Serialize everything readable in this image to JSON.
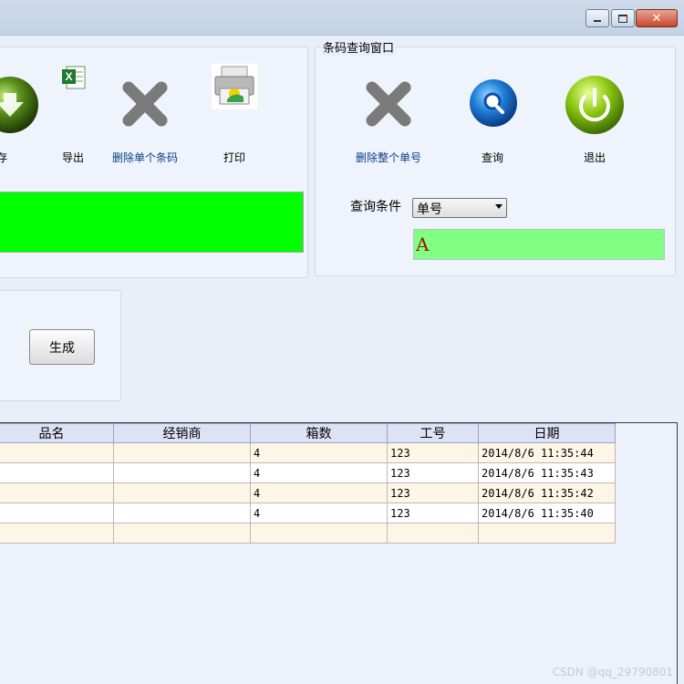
{
  "window": {
    "controls": [
      "minimize",
      "maximize",
      "close"
    ]
  },
  "toolbar": {
    "save_label": "保存",
    "export_label": "导出",
    "delete_single_label": "删除单个条码",
    "print_label": "打印"
  },
  "query_window": {
    "title": "条码查询窗口",
    "delete_order_label": "删除整个单号",
    "query_label": "查询",
    "exit_label": "退出",
    "condition_label": "查询条件",
    "condition_selected": "单号",
    "condition_value": "A"
  },
  "generate": {
    "button_label": "生成"
  },
  "grid": {
    "columns": [
      "品名",
      "经销商",
      "箱数",
      "工号",
      "日期"
    ],
    "rows": [
      {
        "name": "",
        "dealer": "",
        "boxes": "4",
        "worker_id": "123",
        "date": "2014/8/6 11:35:44"
      },
      {
        "name": "",
        "dealer": "",
        "boxes": "4",
        "worker_id": "123",
        "date": "2014/8/6 11:35:43"
      },
      {
        "name": "",
        "dealer": "",
        "boxes": "4",
        "worker_id": "123",
        "date": "2014/8/6 11:35:42"
      },
      {
        "name": "",
        "dealer": "",
        "boxes": "4",
        "worker_id": "123",
        "date": "2014/8/6 11:35:40"
      },
      {
        "name": "",
        "dealer": "",
        "boxes": "",
        "worker_id": "",
        "date": ""
      }
    ]
  },
  "watermark": "CSDN @qq_29790801",
  "colors": {
    "status_green": "#00ff00",
    "input_green": "#80ff80",
    "window_bg": "#e9eff9",
    "row_alt": "#fdf5e6"
  }
}
